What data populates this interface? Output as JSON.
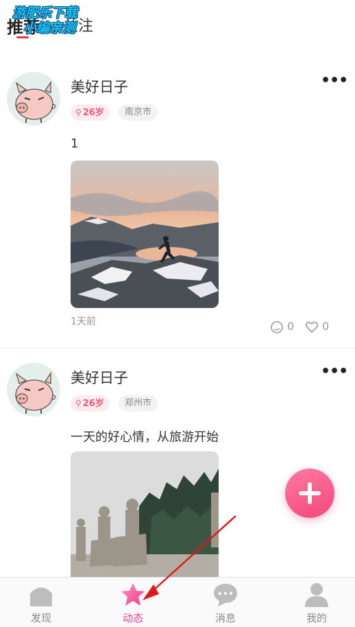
{
  "header": {
    "tabs": [
      {
        "label": "推荐",
        "active": true
      },
      {
        "label": "关注",
        "active": false
      }
    ],
    "watermark": {
      "line1": "游肥乐下载",
      "line2": "小编亲测"
    }
  },
  "posts": [
    {
      "username": "美好日子",
      "age": "26岁",
      "city": "南京市",
      "text": "1",
      "time": "1天前",
      "comments": "0",
      "likes": "0"
    },
    {
      "username": "美好日子",
      "age": "26岁",
      "city": "郑州市",
      "text": "一天的好心情，从旅游开始"
    }
  ],
  "bottom_nav": {
    "items": [
      {
        "label": "发现",
        "icon": "home-icon",
        "active": false
      },
      {
        "label": "动态",
        "icon": "star-icon",
        "active": true
      },
      {
        "label": "消息",
        "icon": "chat-bubble-icon",
        "active": false
      },
      {
        "label": "我的",
        "icon": "person-icon",
        "active": false
      }
    ]
  },
  "colors": {
    "accent_pink": "#ee3e8c",
    "badge_text": "#f25774",
    "fab_gradient": [
      "#ff7aa0",
      "#f4477c"
    ],
    "annotation_arrow": "#e01818"
  }
}
